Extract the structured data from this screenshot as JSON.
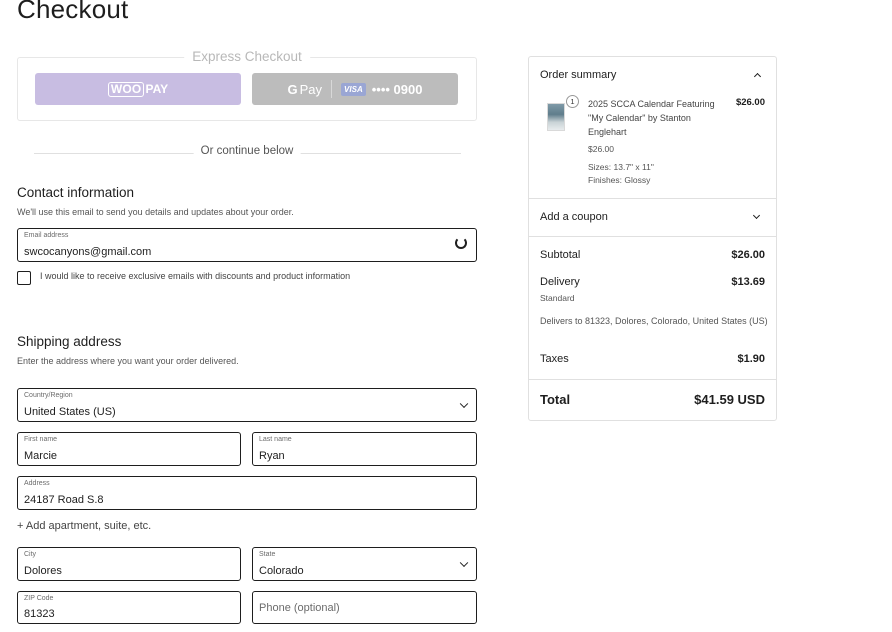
{
  "page": {
    "title": "Checkout"
  },
  "express": {
    "title": "Express Checkout",
    "woopay": {
      "woo": "WOO",
      "pay": "PAY"
    },
    "gpay": {
      "g": "G",
      "pay": "Pay",
      "card_brand": "VISA",
      "card_last": "•••• 0900"
    }
  },
  "divider": {
    "text": "Or continue below"
  },
  "contact": {
    "title": "Contact information",
    "subtitle": "We'll use this email to send you details and updates about your order.",
    "email": {
      "label": "Email address",
      "value": "swcocanyons@gmail.com"
    },
    "optin_label": "I would like to receive exclusive emails with discounts and product information"
  },
  "shipping": {
    "title": "Shipping address",
    "subtitle": "Enter the address where you want your order delivered.",
    "country": {
      "label": "Country/Region",
      "value": "United States (US)"
    },
    "first_name": {
      "label": "First name",
      "value": "Marcie"
    },
    "last_name": {
      "label": "Last name",
      "value": "Ryan"
    },
    "address": {
      "label": "Address",
      "value": "24187 Road S.8"
    },
    "add_apartment": "+ Add apartment, suite, etc.",
    "city": {
      "label": "City",
      "value": "Dolores"
    },
    "state": {
      "label": "State",
      "value": "Colorado"
    },
    "zip": {
      "label": "ZIP Code",
      "value": "81323"
    },
    "phone": {
      "placeholder": "Phone (optional)"
    }
  },
  "summary": {
    "title": "Order summary",
    "item": {
      "qty": "1",
      "name": "2025 SCCA Calendar Featuring \"My Calendar\" by Stanton Englehart",
      "line_price": "$26.00",
      "unit_price": "$26.00",
      "size": "Sizes: 13.7\" x 11\"",
      "finish": "Finishes: Glossy"
    },
    "coupon": "Add a coupon",
    "subtotal": {
      "label": "Subtotal",
      "value": "$26.00"
    },
    "delivery": {
      "label": "Delivery",
      "value": "$13.69",
      "method": "Standard",
      "note": "Delivers to 81323, Dolores, Colorado, United States (US)"
    },
    "taxes": {
      "label": "Taxes",
      "value": "$1.90"
    },
    "total": {
      "label": "Total",
      "value": "$41.59 USD"
    }
  },
  "colors": {
    "woopay": "#c8bde2",
    "gpay": "#bcbcbc",
    "border": "#e0e0e0",
    "text": "#1e1e1e"
  }
}
